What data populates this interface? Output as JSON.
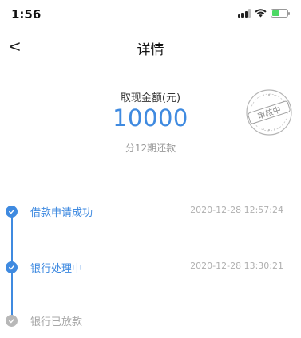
{
  "status_bar": {
    "time": "1:56",
    "wifi_icon": "wifi-icon",
    "battery_color": "#4cd964"
  },
  "nav": {
    "back_icon": "chevron-left-icon",
    "back_glyph": "<",
    "title": "详情"
  },
  "summary": {
    "amount_label": "取现金额(元)",
    "amount": "10000",
    "installments": "分12期还款",
    "stamp_text": "审核中"
  },
  "timeline": {
    "steps": [
      {
        "label": "借款申请成功",
        "time": "2020-12-28 12:57:24",
        "state": "done"
      },
      {
        "label": "银行处理中",
        "time": "2020-12-28 13:30:21",
        "state": "done"
      },
      {
        "label": "银行已放款",
        "time": "",
        "state": "pending"
      }
    ]
  },
  "colors": {
    "accent": "#3f8ae0",
    "pending": "#b8b8b8",
    "muted_text": "#9a9a9a"
  }
}
